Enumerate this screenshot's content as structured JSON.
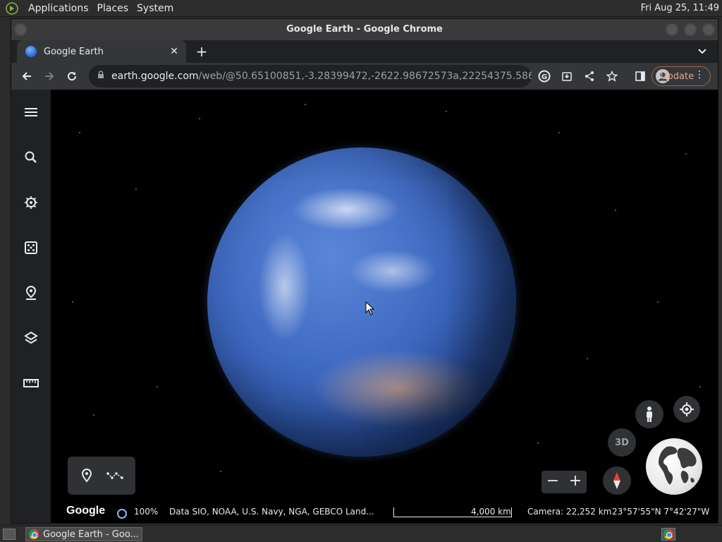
{
  "desktop": {
    "menus": [
      "Applications",
      "Places",
      "System"
    ],
    "clock": "Fri Aug 25, 11:49"
  },
  "window": {
    "title": "Google Earth - Google Chrome"
  },
  "browser": {
    "tab_title": "Google Earth",
    "tab_close": "✕",
    "new_tab": "+",
    "url_host": "earth.google.com",
    "url_path": "/web/@50.65100851,-3.28399472,-2622.98672573a,22254375.58696...",
    "update_label": "Update"
  },
  "earth": {
    "footer": {
      "logo": "Google",
      "load_percent": "100%",
      "attribution": "Data SIO, NOAA, U.S. Navy, NGA, GEBCO  Land...",
      "scale": "4,000 km",
      "camera": "Camera: 22,252 km",
      "coords": "23°57'55\"N 7°42'27\"W"
    },
    "view_mode": "3D",
    "zoom_out": "−",
    "zoom_in": "+",
    "sidebar_icons": [
      "menu-icon",
      "search-icon",
      "voyager-icon",
      "feeling-lucky-icon",
      "projects-icon",
      "map-style-icon",
      "measure-icon"
    ]
  },
  "taskbar": {
    "task_label": "Google Earth - Goo..."
  }
}
